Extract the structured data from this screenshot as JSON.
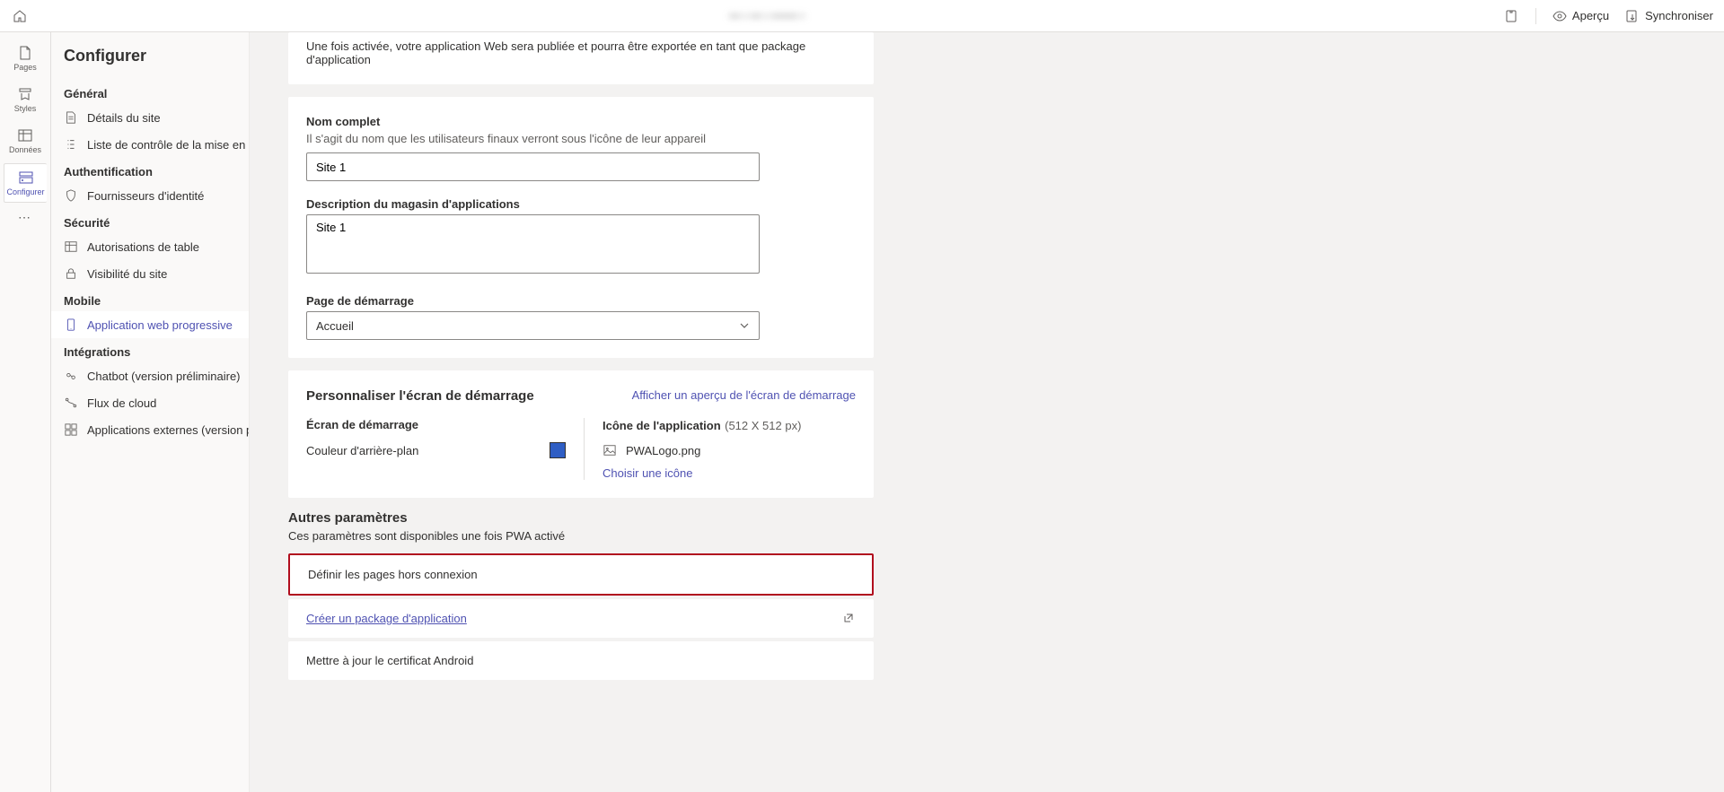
{
  "topbar": {
    "centerText": "••• • ••• • ••••••• •",
    "preview": "Aperçu",
    "sync": "Synchroniser"
  },
  "rail": {
    "items": [
      {
        "label": "Pages"
      },
      {
        "label": "Styles"
      },
      {
        "label": "Données"
      },
      {
        "label": "Configurer"
      }
    ]
  },
  "sidebar": {
    "title": "Configurer",
    "groups": [
      {
        "label": "Général",
        "items": [
          {
            "label": "Détails du site"
          },
          {
            "label": "Liste de contrôle de la mise en ser..."
          }
        ]
      },
      {
        "label": "Authentification",
        "items": [
          {
            "label": "Fournisseurs d'identité"
          }
        ]
      },
      {
        "label": "Sécurité",
        "items": [
          {
            "label": "Autorisations de table"
          },
          {
            "label": "Visibilité du site"
          }
        ]
      },
      {
        "label": "Mobile",
        "items": [
          {
            "label": "Application web progressive"
          }
        ]
      },
      {
        "label": "Intégrations",
        "items": [
          {
            "label": "Chatbot (version préliminaire)"
          },
          {
            "label": "Flux de cloud"
          },
          {
            "label": "Applications externes (version prél..."
          }
        ]
      }
    ]
  },
  "content": {
    "enableNote": "Une fois activée, votre application Web sera publiée et pourra être exportée en tant que package d'application",
    "fullName": {
      "label": "Nom complet",
      "help": "Il s'agit du nom que les utilisateurs finaux verront sous l'icône de leur appareil",
      "value": "Site 1"
    },
    "storeDesc": {
      "label": "Description du magasin d'applications",
      "value": "Site 1"
    },
    "startPage": {
      "label": "Page de démarrage",
      "value": "Accueil"
    },
    "splash": {
      "title": "Personnaliser l'écran de démarrage",
      "previewLink": "Afficher un aperçu de l'écran de démarrage",
      "startLabel": "Écran de démarrage",
      "bgLabel": "Couleur d'arrière-plan",
      "bgColor": "#2f5ec4",
      "iconLabel": "Icône de l'application",
      "iconSize": "(512 X 512 px)",
      "iconFile": "PWALogo.png",
      "chooseIcon": "Choisir une icône"
    },
    "other": {
      "title": "Autres paramètres",
      "note": "Ces paramètres sont disponibles une fois PWA activé",
      "offline": "Définir les pages hors connexion",
      "createPkg": "Créer un package d'application",
      "updateCert": "Mettre à jour le certificat Android"
    }
  }
}
